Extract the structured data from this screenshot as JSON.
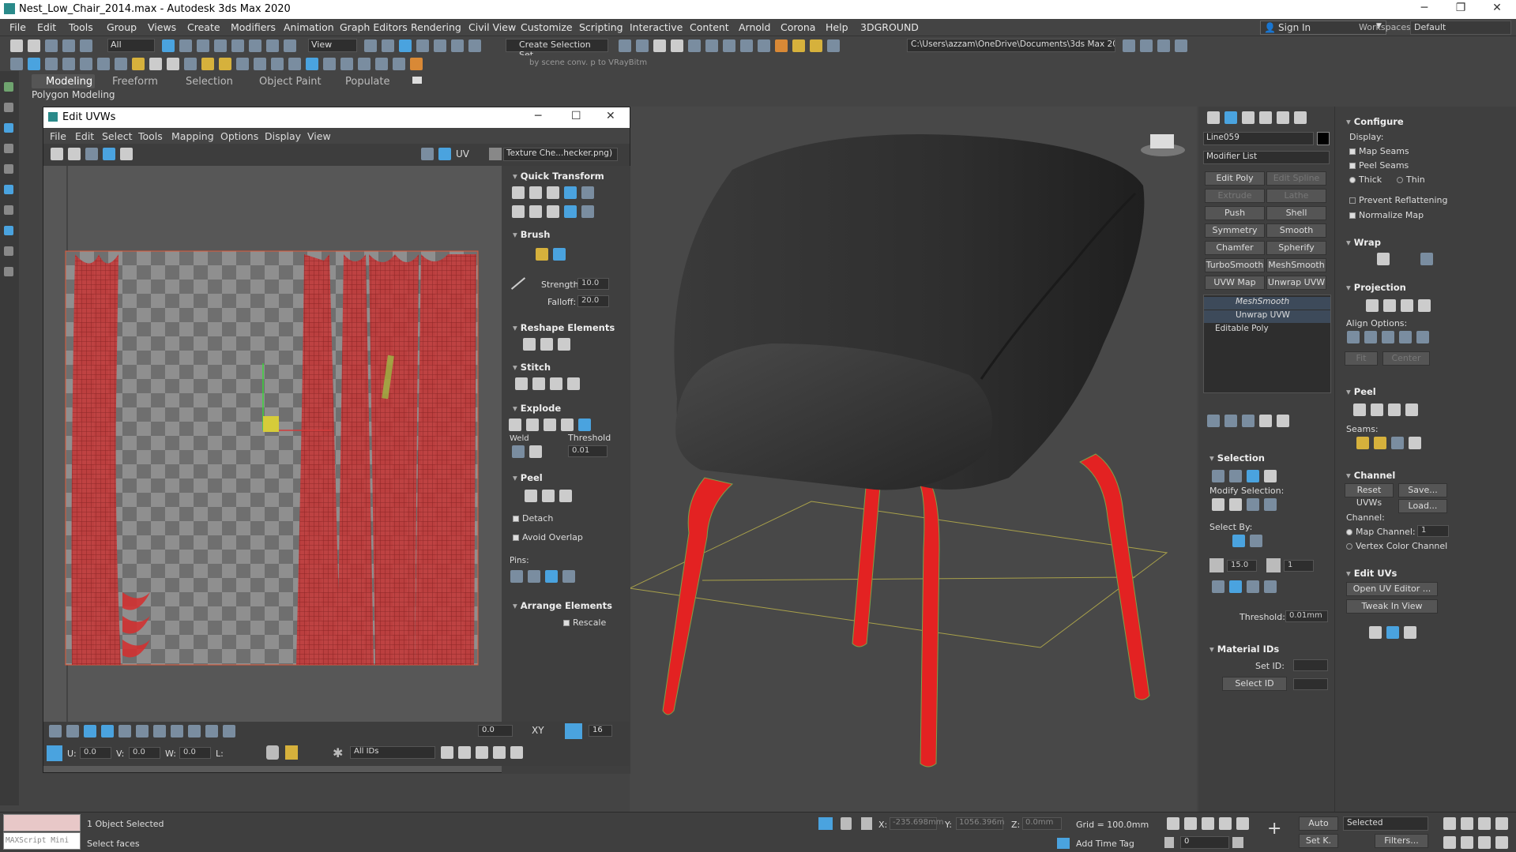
{
  "app": {
    "title": "Nest_Low_Chair_2014.max - Autodesk 3ds Max 2020"
  },
  "menu": [
    "File",
    "Edit",
    "Tools",
    "Group",
    "Views",
    "Create",
    "Modifiers",
    "Animation",
    "Graph Editors",
    "Rendering",
    "Civil View",
    "Customize",
    "Scripting",
    "Interactive",
    "Content",
    "Arnold",
    "Corona",
    "Help",
    "3DGROUND"
  ],
  "header_right": {
    "signin": "Sign In",
    "workspaces_label": "Workspaces:",
    "workspace": "Default"
  },
  "toolbar": {
    "filter": "All",
    "view": "View",
    "selection_set": "Create Selection Set",
    "path": "C:\\Users\\azzam\\OneDrive\\Documents\\3ds Max 2020",
    "vray_hint": "by scene conv. p to VRayBitm"
  },
  "ribbon": {
    "tabs": [
      "Modeling",
      "Freeform",
      "Selection",
      "Object Paint",
      "Populate"
    ],
    "sub": "Polygon Modeling"
  },
  "viewport": {
    "label": "[+]"
  },
  "uvw": {
    "title": "Edit UVWs",
    "menu": [
      "File",
      "Edit",
      "Select",
      "Tools",
      "Mapping",
      "Options",
      "Display",
      "View"
    ],
    "uv_label": "UV",
    "texture": "Texture Che...hecker.png)",
    "panel": {
      "quick_transform": "Quick Transform",
      "brush": "Brush",
      "strength_label": "Strength:",
      "strength": "10.0",
      "falloff_label": "Falloff:",
      "falloff": "20.0",
      "reshape": "Reshape Elements",
      "stitch": "Stitch",
      "explode": "Explode",
      "weld": "Weld",
      "threshold_label": "Threshold",
      "threshold": "0.01",
      "peel": "Peel",
      "detach": "Detach",
      "avoid_overlap": "Avoid Overlap",
      "pins": "Pins:",
      "arrange": "Arrange Elements",
      "rescale": "Rescale"
    },
    "bottom": {
      "spin1": "0.0",
      "spin2": "16",
      "u_label": "U:",
      "u": "0.0",
      "v_label": "V:",
      "v": "0.0",
      "w_label": "W:",
      "w": "0.0",
      "l_label": "L:",
      "ids": "All IDs",
      "xy": "XY"
    }
  },
  "cmd": {
    "object_name": "Line059",
    "modifier_list": "Modifier List",
    "buttons": [
      [
        "Edit Poly",
        "Edit Spline"
      ],
      [
        "Extrude",
        "Lathe"
      ],
      [
        "Push",
        "Shell"
      ],
      [
        "Symmetry",
        "Smooth"
      ],
      [
        "Chamfer",
        "Spherify"
      ],
      [
        "TurboSmooth",
        "MeshSmooth"
      ],
      [
        "UVW Map",
        "Unwrap UVW"
      ]
    ],
    "stack": [
      "MeshSmooth",
      "Unwrap UVW",
      "Editable Poly"
    ],
    "selection": {
      "title": "Selection",
      "modify": "Modify Selection:",
      "select_by": "Select By:",
      "angle": "15.0",
      "count": "1",
      "threshold_label": "Threshold:",
      "threshold": "0.01mm"
    },
    "material_ids": {
      "title": "Material IDs",
      "set_id": "Set ID:",
      "select_id": "Select ID"
    }
  },
  "rollouts": {
    "configure": "Configure",
    "display": "Display:",
    "map_seams": "Map Seams",
    "peel_seams": "Peel Seams",
    "thick": "Thick",
    "thin": "Thin",
    "prevent": "Prevent Reflattening",
    "normalize": "Normalize Map",
    "wrap": "Wrap",
    "projection": "Projection",
    "align": "Align Options:",
    "fit": "Fit",
    "center": "Center",
    "peel": "Peel",
    "seams": "Seams:",
    "channel": "Channel",
    "reset_uvws": "Reset UVWs",
    "save": "Save...",
    "load": "Load...",
    "channel_label": "Channel:",
    "map_channel": "Map Channel:",
    "map_channel_val": "1",
    "vertex_color": "Vertex Color Channel",
    "edit_uvs": "Edit UVs",
    "open_uv": "Open UV Editor ...",
    "tweak": "Tweak In View"
  },
  "status": {
    "script": "MAXScript Mini",
    "selected": "1 Object Selected",
    "prompt": "Select faces",
    "x_label": "X:",
    "x": "-235.698mm",
    "y_label": "Y:",
    "y": "1056.396m",
    "z_label": "Z:",
    "z": "0.0mm",
    "grid": "Grid = 100.0mm",
    "add_time_tag": "Add Time Tag",
    "auto": "Auto",
    "selected_dd": "Selected",
    "setk": "Set K.",
    "filters": "Filters...",
    "frame": "0"
  }
}
